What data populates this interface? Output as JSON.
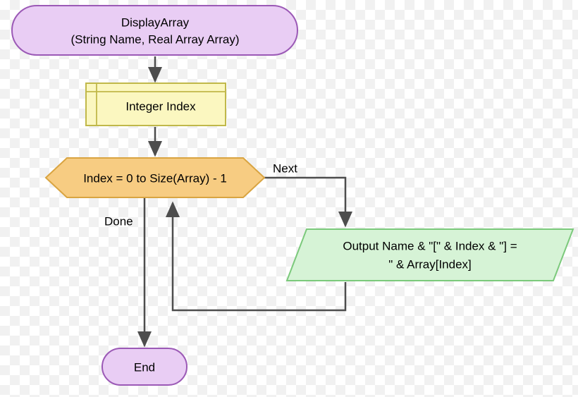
{
  "start": {
    "line1": "DisplayArray",
    "line2": "(String Name, Real Array Array)"
  },
  "declare": {
    "text": "Integer Index"
  },
  "loop": {
    "text": "Index = 0 to Size(Array) - 1"
  },
  "labels": {
    "next": "Next",
    "done": "Done"
  },
  "output": {
    "line1": "Output Name & \"[\" & Index & \"] = ",
    "line2": "\" & Array[Index]"
  },
  "end": {
    "text": "End"
  },
  "colors": {
    "purpleFill": "#e9cdf4",
    "purpleStroke": "#9b59b6",
    "yellowFill": "#fbf7c0",
    "yellowStroke": "#c0b84a",
    "orangeFill": "#f7cc82",
    "orangeStroke": "#d9a441",
    "greenFill": "#d6f3d6",
    "greenStroke": "#7bc97b",
    "arrow": "#4d4d4d"
  },
  "chart_data": {
    "type": "flowchart",
    "title": "DisplayArray procedure",
    "nodes": [
      {
        "id": "start",
        "kind": "terminator",
        "label": "DisplayArray (String Name, Real Array Array)"
      },
      {
        "id": "declare",
        "kind": "declaration",
        "label": "Integer Index"
      },
      {
        "id": "loop",
        "kind": "loop",
        "label": "Index = 0 to Size(Array) - 1"
      },
      {
        "id": "output",
        "kind": "io",
        "label": "Output Name & \"[\" & Index & \"] = \" & Array[Index]"
      },
      {
        "id": "end",
        "kind": "terminator",
        "label": "End"
      }
    ],
    "edges": [
      {
        "from": "start",
        "to": "declare"
      },
      {
        "from": "declare",
        "to": "loop"
      },
      {
        "from": "loop",
        "to": "output",
        "label": "Next"
      },
      {
        "from": "output",
        "to": "loop",
        "back": true
      },
      {
        "from": "loop",
        "to": "end",
        "label": "Done"
      }
    ]
  }
}
